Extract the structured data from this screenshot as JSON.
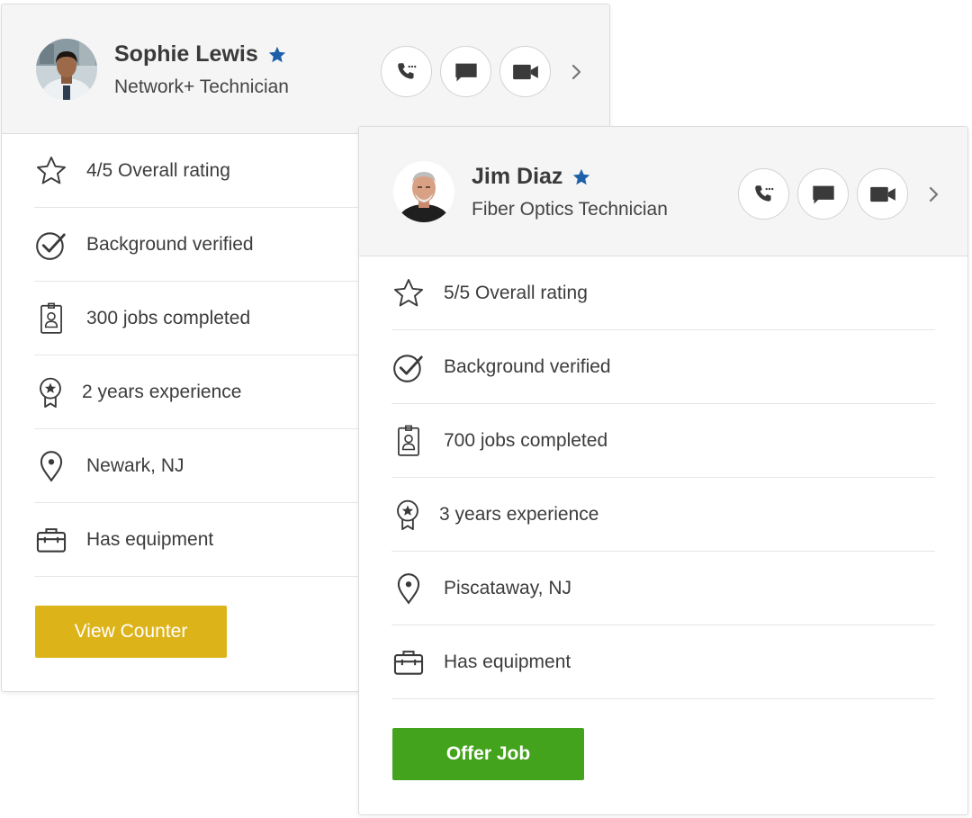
{
  "colors": {
    "star_blue": "#1d5fa8",
    "view_counter_bg": "#ddb31a",
    "offer_job_bg": "#44a31d",
    "header_bg": "#f5f5f5",
    "icon_dark": "#3a3a3a"
  },
  "cards": [
    {
      "name": "Sophie Lewis",
      "title": "Network+ Technician",
      "avatar_icon": "avatar-photo",
      "featured_icon": "star-filled-icon",
      "contact_buttons": [
        "phone-icon",
        "message-icon",
        "video-icon"
      ],
      "details": [
        {
          "icon": "star-outline-icon",
          "text": "4/5 Overall rating"
        },
        {
          "icon": "check-circle-icon",
          "text": "Background verified"
        },
        {
          "icon": "id-badge-icon",
          "text": "300 jobs completed"
        },
        {
          "icon": "medal-icon",
          "text": "2 years experience"
        },
        {
          "icon": "location-pin-icon",
          "text": "Newark, NJ"
        },
        {
          "icon": "toolbox-icon",
          "text": "Has equipment"
        }
      ],
      "action_label": "View Counter"
    },
    {
      "name": "Jim Diaz",
      "title": "Fiber Optics Technician",
      "avatar_icon": "avatar-photo",
      "featured_icon": "star-filled-icon",
      "contact_buttons": [
        "phone-icon",
        "message-icon",
        "video-icon"
      ],
      "details": [
        {
          "icon": "star-outline-icon",
          "text": "5/5 Overall rating"
        },
        {
          "icon": "check-circle-icon",
          "text": "Background verified"
        },
        {
          "icon": "id-badge-icon",
          "text": "700 jobs completed"
        },
        {
          "icon": "medal-icon",
          "text": "3 years experience"
        },
        {
          "icon": "location-pin-icon",
          "text": "Piscataway, NJ"
        },
        {
          "icon": "toolbox-icon",
          "text": "Has equipment"
        }
      ],
      "action_label": "Offer Job"
    }
  ]
}
